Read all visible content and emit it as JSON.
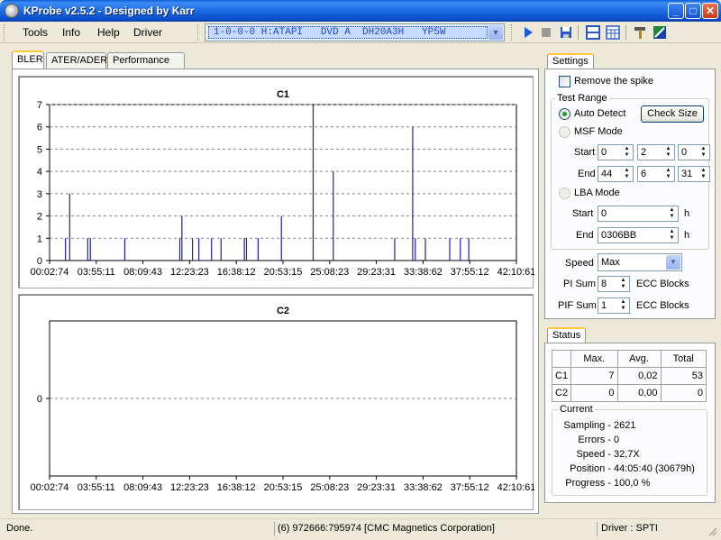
{
  "window": {
    "title": "KProbe v2.5.2 - Designed by Karr"
  },
  "menu": {
    "tools": "Tools",
    "info": "Info",
    "help": "Help",
    "driver": "Driver"
  },
  "drive": {
    "selected": "1-0-0-0 H:ATAPI   DVD A  DH20A3H   YP5W"
  },
  "toolbar_icons": [
    "play-icon",
    "stop-icon",
    "save-icon",
    "layout-icon",
    "grid-icon",
    "tools-icon",
    "media-icon"
  ],
  "tabs": [
    "BLER",
    "ATER/ADER",
    "Performance"
  ],
  "settings": {
    "tab_label": "Settings",
    "remove_spike": "Remove the spike",
    "test_range": "Test Range",
    "auto_detect": "Auto Detect",
    "check_size": "Check Size",
    "msf_mode": "MSF Mode",
    "start_label": "Start",
    "end_label": "End",
    "msf_start": [
      "0",
      "2",
      "0"
    ],
    "msf_end": [
      "44",
      "6",
      "31"
    ],
    "lba_mode": "LBA Mode",
    "lba_start": "0",
    "lba_end": "0306BB",
    "h": "h",
    "speed_label": "Speed",
    "speed_value": "Max",
    "pi_sum_label": "PI Sum",
    "pi_sum_value": "8",
    "pif_sum_label": "PIF Sum",
    "pif_sum_value": "1",
    "ecc_blocks": "ECC Blocks"
  },
  "status": {
    "tab_label": "Status",
    "headers": [
      "",
      "Max.",
      "Avg.",
      "Total"
    ],
    "rows": [
      {
        "name": "C1",
        "max": "7",
        "avg": "0,02",
        "total": "53"
      },
      {
        "name": "C2",
        "max": "0",
        "avg": "0,00",
        "total": "0"
      }
    ],
    "current_title": "Current",
    "sampling_label": "Sampling -",
    "sampling": "2621",
    "errors_label": "Errors -",
    "errors": "0",
    "speed_label": "Speed -",
    "speed": "32,7X",
    "position_label": "Position -",
    "position": "44:05:40 (30679h)",
    "progress_label": "Progress -",
    "progress": "100,0 %"
  },
  "statusbar": {
    "left": "Done.",
    "middle": "(6) 972666:795974 [CMC Magnetics Corporation]",
    "right": "Driver : SPTI"
  },
  "colors": {
    "bar": "#1F1FB0",
    "gridline": "#808080"
  },
  "chart_data": [
    {
      "type": "bar",
      "title": "C1",
      "xlabel": "",
      "ylabel": "",
      "ylim": [
        0,
        7
      ],
      "yticks": [
        "0",
        "1",
        "2",
        "3",
        "4",
        "5",
        "6",
        "7"
      ],
      "x_ticks": [
        "00:02:74",
        "03:55:11",
        "08:09:43",
        "12:23:23",
        "16:38:12",
        "20:53:15",
        "25:08:23",
        "29:23:31",
        "33:38:62",
        "37:55:12",
        "42:10:61"
      ],
      "x_range_minutes": [
        0,
        44.1
      ],
      "grid": "horizontal dashed",
      "series": [
        {
          "x": [
            1.5,
            1.9,
            3.6,
            3.85,
            7.1,
            12.3,
            12.5,
            13.5,
            14.1,
            15.3,
            16.2,
            18.4,
            18.6,
            19.7,
            21.9,
            24.9,
            26.8,
            32.6,
            34.3,
            34.55,
            35.5,
            37.8,
            38.8,
            39.6
          ],
          "values": [
            1,
            3,
            1,
            1,
            1,
            1,
            2,
            1,
            1,
            1,
            1,
            1,
            1,
            1,
            2,
            7,
            4,
            1,
            6,
            1,
            1,
            1,
            1,
            1
          ]
        }
      ]
    },
    {
      "type": "bar",
      "title": "C2",
      "xlabel": "",
      "ylabel": "",
      "yticks": [
        "0"
      ],
      "x_ticks": [
        "00:02:74",
        "03:55:11",
        "08:09:43",
        "12:23:23",
        "16:38:12",
        "20:53:15",
        "25:08:23",
        "29:23:31",
        "33:38:62",
        "37:55:12",
        "42:10:61"
      ],
      "grid": "horizontal dashed",
      "series": [
        {
          "x": [],
          "values": []
        }
      ]
    }
  ]
}
